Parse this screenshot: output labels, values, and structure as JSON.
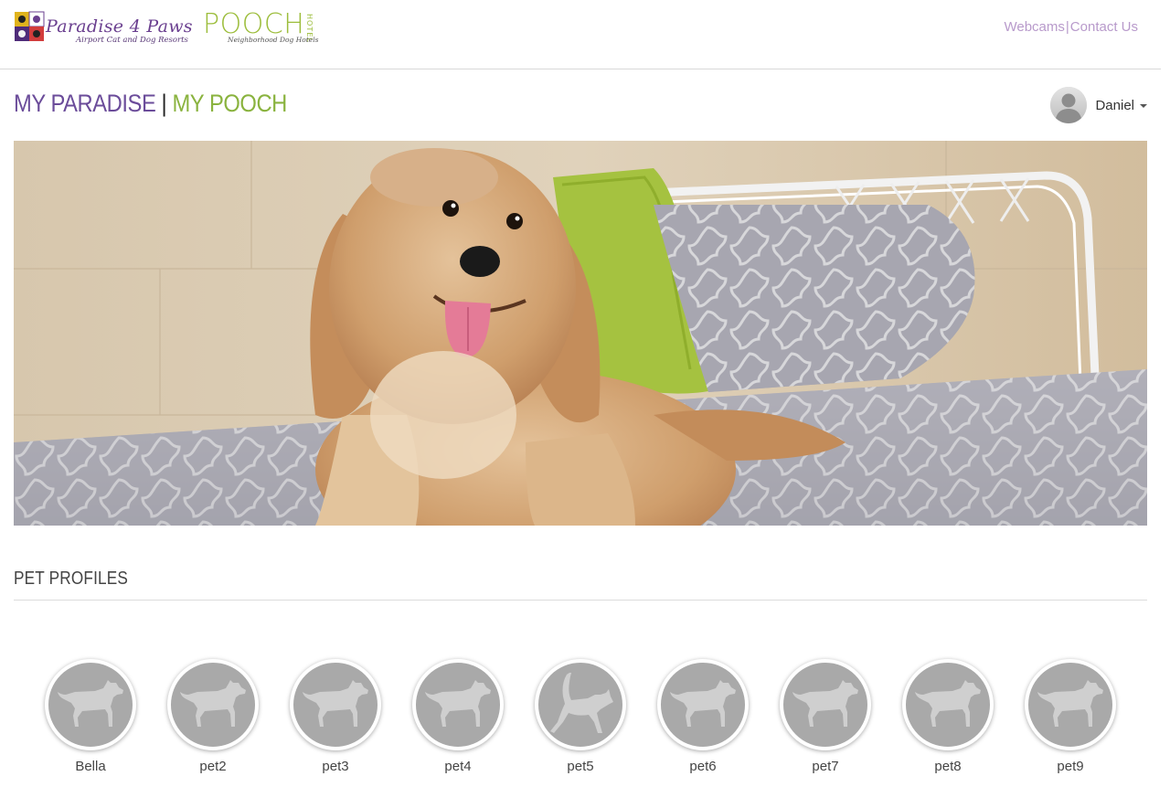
{
  "header": {
    "logo_primary": {
      "name": "Paradise 4 Paws",
      "tagline": "Airport Cat and Dog Resorts"
    },
    "logo_secondary": {
      "name": "POOCH",
      "vertical": "HOTEL",
      "tagline": "Neighborhood Dog Hotels"
    },
    "links": [
      {
        "label": "Webcams"
      },
      {
        "label": "Contact Us"
      }
    ],
    "link_separator": "|"
  },
  "brand": {
    "part1": "MY PARADISE",
    "separator": "|",
    "part2": "MY POOCH"
  },
  "user": {
    "name": "Daniel",
    "avatar_icon": "user-silhouette-icon"
  },
  "hero": {
    "image": "dog-on-bed-photo"
  },
  "pets_section": {
    "title": "PET PROFILES",
    "pets": [
      {
        "name": "Bella",
        "icon": "dog-icon"
      },
      {
        "name": "pet2",
        "icon": "dog-icon"
      },
      {
        "name": "pet3",
        "icon": "dog-icon"
      },
      {
        "name": "pet4",
        "icon": "dog-icon"
      },
      {
        "name": "pet5",
        "icon": "cat-icon"
      },
      {
        "name": "pet6",
        "icon": "dog-icon"
      },
      {
        "name": "pet7",
        "icon": "dog-icon"
      },
      {
        "name": "pet8",
        "icon": "dog-icon"
      },
      {
        "name": "pet9",
        "icon": "dog-icon"
      }
    ]
  },
  "colors": {
    "paradise_purple": "#6b4c9a",
    "pooch_green": "#8ab33f",
    "link_lilac": "#b89acb",
    "pet_circle": "#a9a9a9"
  }
}
